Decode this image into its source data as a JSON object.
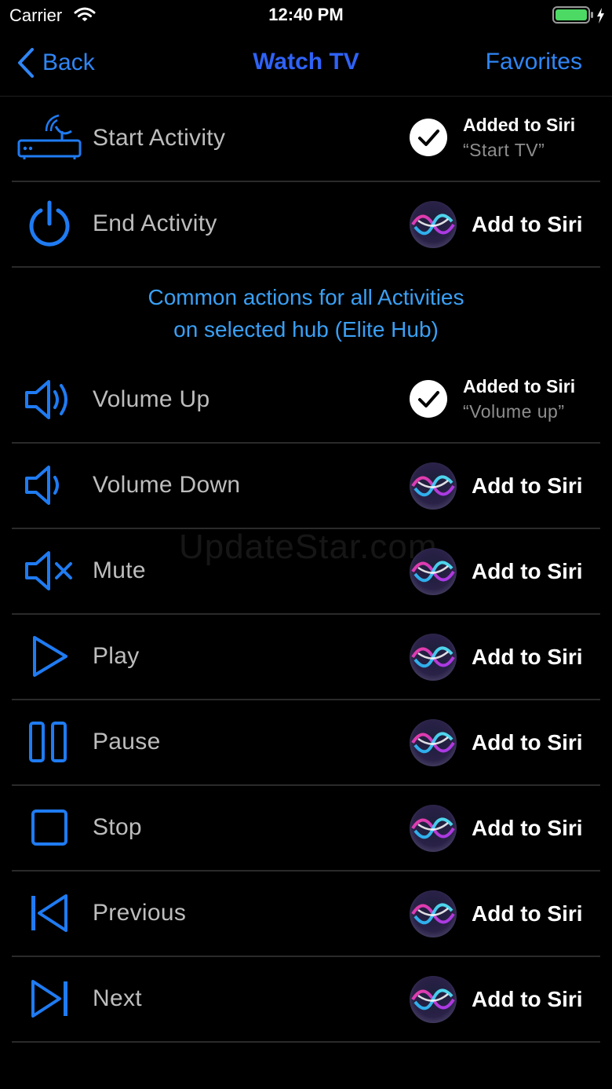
{
  "status": {
    "carrier": "Carrier",
    "time": "12:40 PM"
  },
  "nav": {
    "back": "Back",
    "title": "Watch TV",
    "favorites": "Favorites"
  },
  "section_header": {
    "line1": "Common actions for all Activities",
    "line2": "on selected hub (Elite Hub)"
  },
  "watermark": "UpdateStar.com",
  "rows": [
    {
      "label": "Start Activity",
      "icon": "hub-icon",
      "added": true,
      "status": "Added to Siri",
      "phrase": "“Start TV”"
    },
    {
      "label": "End Activity",
      "icon": "power-icon",
      "added": false,
      "status": "Add to Siri"
    },
    {
      "label": "Volume Up",
      "icon": "volume-up-icon",
      "added": true,
      "status": "Added to Siri",
      "phrase": "“Volume up”"
    },
    {
      "label": "Volume Down",
      "icon": "volume-down-icon",
      "added": false,
      "status": "Add to Siri"
    },
    {
      "label": "Mute",
      "icon": "mute-icon",
      "added": false,
      "status": "Add to Siri"
    },
    {
      "label": "Play",
      "icon": "play-icon",
      "added": false,
      "status": "Add to Siri"
    },
    {
      "label": "Pause",
      "icon": "pause-icon",
      "added": false,
      "status": "Add to Siri"
    },
    {
      "label": "Stop",
      "icon": "stop-icon",
      "added": false,
      "status": "Add to Siri"
    },
    {
      "label": "Previous",
      "icon": "previous-icon",
      "added": false,
      "status": "Add to Siri"
    },
    {
      "label": "Next",
      "icon": "next-icon",
      "added": false,
      "status": "Add to Siri"
    }
  ],
  "colors": {
    "accent": "#2f86f6",
    "title": "#2f62f6",
    "icon": "#1f7bf2",
    "section": "#3aa0f5",
    "battery": "#4cd964"
  }
}
